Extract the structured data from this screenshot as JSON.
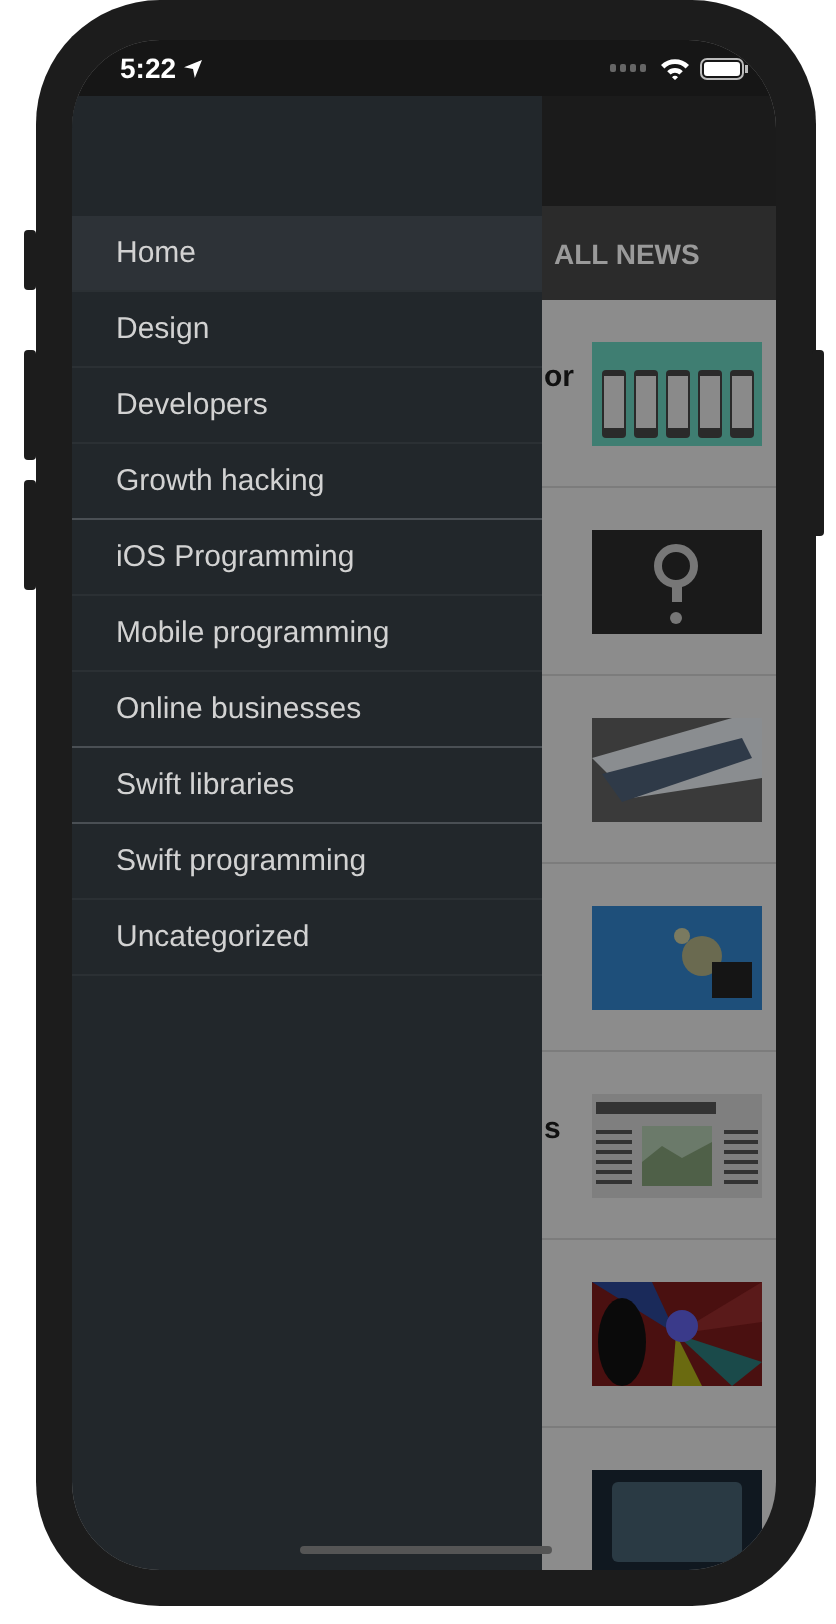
{
  "status_bar": {
    "time": "5:22"
  },
  "tab_bar": {
    "label": "ALL NEWS"
  },
  "articles": [
    {
      "title": "or",
      "thumbnail": {
        "kind": "picture"
      }
    },
    {
      "thumbnail": {
        "kind": "picture"
      }
    },
    {
      "thumbnail": {
        "kind": "picture"
      }
    },
    {
      "thumbnail": {
        "kind": "picture"
      }
    },
    {
      "title": "s",
      "thumbnail": {
        "kind": "picture"
      }
    },
    {
      "thumbnail": {
        "kind": "picture"
      }
    },
    {
      "thumbnail": {
        "kind": "picture"
      }
    }
  ],
  "drawer": {
    "items": [
      {
        "label": "Home",
        "selected": true
      },
      {
        "label": "Design",
        "selected": false
      },
      {
        "label": "Developers",
        "selected": false
      },
      {
        "label": "Growth hacking",
        "selected": false
      },
      {
        "label": "iOS Programming",
        "selected": false
      },
      {
        "label": "Mobile programming",
        "selected": false
      },
      {
        "label": "Online businesses",
        "selected": false
      },
      {
        "label": "Swift libraries",
        "selected": false
      },
      {
        "label": "Swift programming",
        "selected": false
      },
      {
        "label": "Uncategorized",
        "selected": false
      }
    ]
  }
}
